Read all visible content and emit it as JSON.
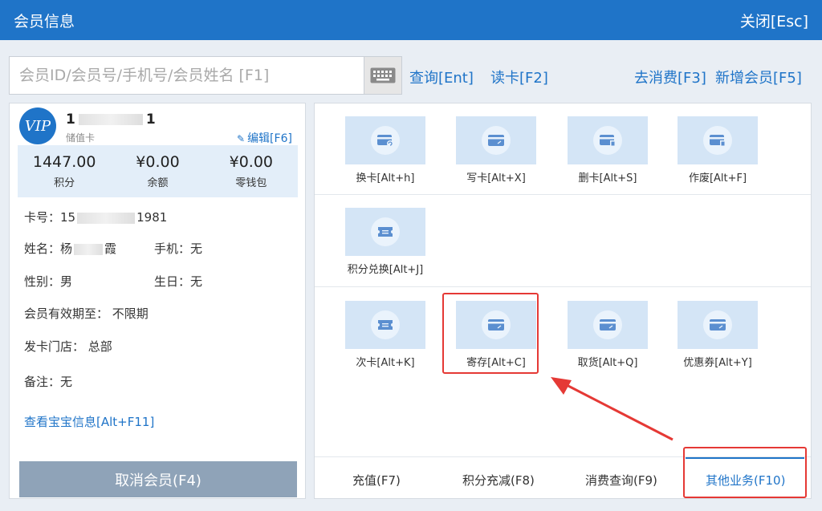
{
  "window": {
    "title": "会员信息",
    "close_label": "关闭[Esc]"
  },
  "search": {
    "placeholder": "会员ID/会员号/手机号/会员姓名 [F1]",
    "value": ""
  },
  "toolbar": {
    "query": "查询[Ent]",
    "read_card": "读卡[F2]",
    "go_consume": "去消费[F3]",
    "add_member": "新增会员[F5]"
  },
  "member": {
    "badge": "VIP",
    "name_visible_start": "1",
    "name_visible_end": "1",
    "card_type": "储值卡",
    "edit_label": "编辑[F6]",
    "stats": [
      {
        "value": "1447.00",
        "label": "积分"
      },
      {
        "value": "¥0.00",
        "label": "余额"
      },
      {
        "value": "¥0.00",
        "label": "零钱包"
      }
    ],
    "card_no_label": "卡号：",
    "card_no_start": "15",
    "card_no_end": "1981",
    "name_label": "姓名：",
    "name_start": "杨",
    "name_end": "霞",
    "phone": "手机：无",
    "gender": "性别：男",
    "birthday": "生日：无",
    "validity": "会员有效期至： 不限期",
    "store": "发卡门店： 总部",
    "remark": "备注：无",
    "baby_link": "查看宝宝信息[Alt+F11]",
    "cancel_button": "取消会员(F4)"
  },
  "tiles": {
    "row1": [
      {
        "label": "换卡[Alt+h]",
        "icon": "card-swap-icon"
      },
      {
        "label": "写卡[Alt+X]",
        "icon": "card-write-icon"
      },
      {
        "label": "删卡[Alt+S]",
        "icon": "card-delete-icon"
      },
      {
        "label": "作废[Alt+F]",
        "icon": "card-void-icon"
      }
    ],
    "row2": [
      {
        "label": "积分兑换[Alt+J]",
        "icon": "ticket-icon"
      }
    ],
    "row3": [
      {
        "label": "次卡[Alt+K]",
        "icon": "ticket-icon"
      },
      {
        "label": "寄存[Alt+C]",
        "icon": "card-write-icon"
      },
      {
        "label": "取货[Alt+Q]",
        "icon": "card-write-icon"
      },
      {
        "label": "优惠券[Alt+Y]",
        "icon": "card-write-icon"
      }
    ]
  },
  "tabs": [
    {
      "label": "充值(F7)"
    },
    {
      "label": "积分充减(F8)"
    },
    {
      "label": "消费查询(F9)"
    },
    {
      "label": "其他业务(F10)",
      "active": true
    }
  ],
  "colors": {
    "primary": "#1f74c8",
    "tile_bg": "#d4e5f6",
    "highlight": "#e53935",
    "cancel_button": "#8fa3b8"
  }
}
